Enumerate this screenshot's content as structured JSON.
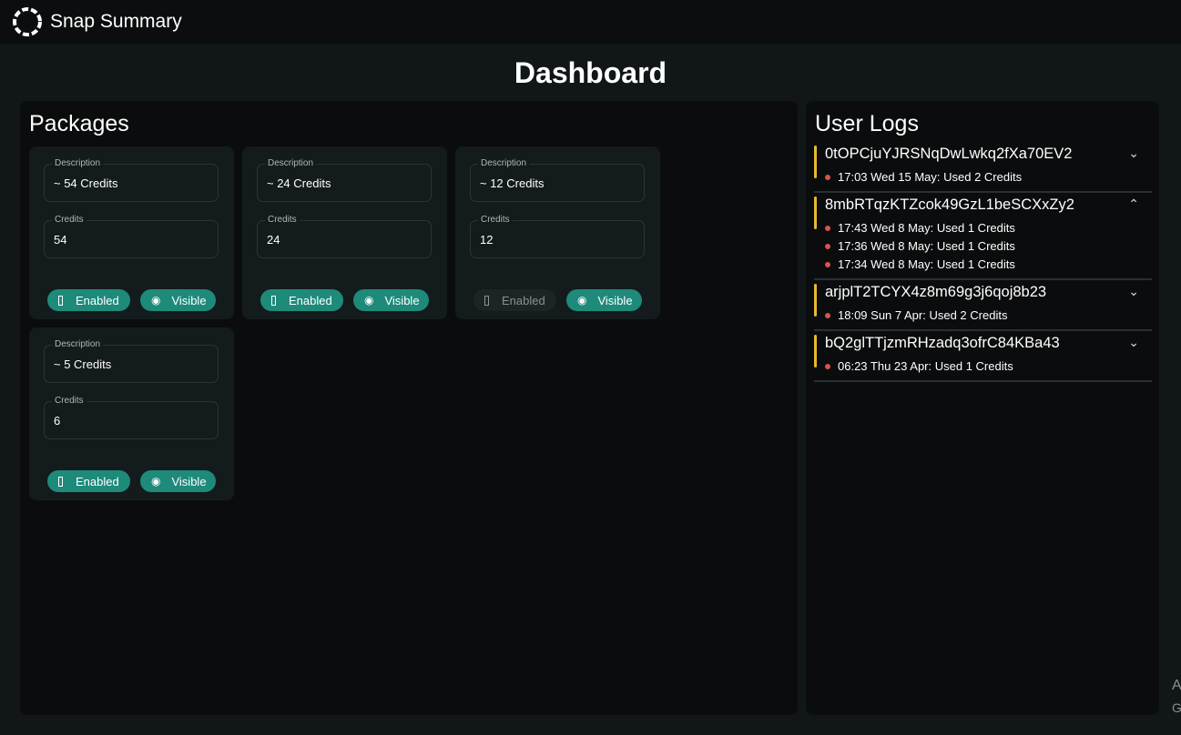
{
  "app": {
    "title": "Snap Summary",
    "icon": "aperture-icon"
  },
  "page": {
    "title": "Dashboard"
  },
  "packages": {
    "heading": "Packages",
    "description_label": "Description",
    "credits_label": "Credits",
    "items": [
      {
        "description": "~ 54 Credits",
        "credits": "54",
        "enabled_label": "Enabled",
        "enabled": true,
        "visible_label": "Visible",
        "visible": true
      },
      {
        "description": "~ 24 Credits",
        "credits": "24",
        "enabled_label": "Enabled",
        "enabled": true,
        "visible_label": "Visible",
        "visible": true
      },
      {
        "description": "~ 12 Credits",
        "credits": "12",
        "enabled_label": "Enabled",
        "enabled": false,
        "visible_label": "Visible",
        "visible": true
      },
      {
        "description": "~ 5 Credits",
        "credits": "6",
        "enabled_label": "Enabled",
        "enabled": true,
        "visible_label": "Visible",
        "visible": true
      }
    ]
  },
  "logs": {
    "heading": "User Logs",
    "entries": [
      {
        "id": "0tOPCjuYJRSNqDwLwkq2fXa70EV2",
        "expanded": false,
        "items": [
          "17:03 Wed 15 May: Used 2 Credits"
        ]
      },
      {
        "id": "8mbRTqzKTZcok49GzL1beSCXxZy2",
        "expanded": true,
        "items": [
          "17:43 Wed 8 May: Used 1 Credits",
          "17:36 Wed 8 May: Used 1 Credits",
          "17:34 Wed 8 May: Used 1 Credits"
        ]
      },
      {
        "id": "arjplT2TCYX4z8m69g3j6qoj8b23",
        "expanded": false,
        "items": [
          "18:09 Sun 7 Apr: Used 2 Credits"
        ]
      },
      {
        "id": "bQ2glTTjzmRHzadq3ofrC84KBa43",
        "expanded": false,
        "items": [
          "06:23 Thu 23 Apr: Used 1 Credits"
        ]
      }
    ]
  },
  "watermark": {
    "line1": "A",
    "line2": "G"
  },
  "colors": {
    "accent": "#1e8a7a",
    "log_bar": "#e8b92f",
    "log_dot": "#d9534f"
  }
}
